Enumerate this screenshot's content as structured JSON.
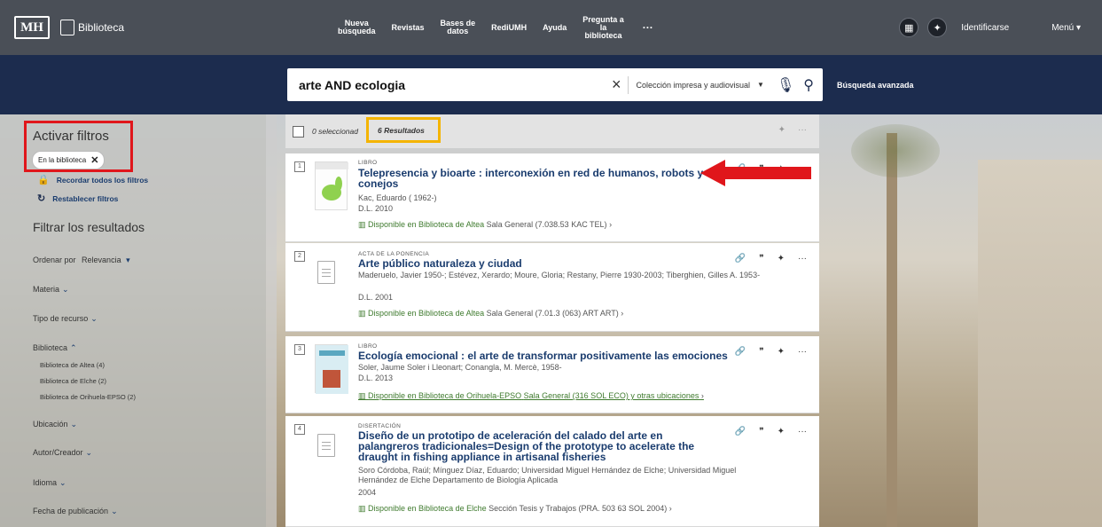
{
  "header": {
    "brand_mark": "MH",
    "brand_name": "Biblioteca",
    "nav": [
      "Nueva\nbúsqueda",
      "Revistas",
      "Bases de\ndatos",
      "RediUMH",
      "Ayuda",
      "Pregunta a\nla\nbiblioteca"
    ],
    "nav_more": "···",
    "login": "Identificarse",
    "menu": "Menú ▾"
  },
  "search": {
    "query": "arte AND ecologia",
    "scope": "Colección impresa y audiovisual",
    "advanced": "Búsqueda avanzada"
  },
  "sidebar": {
    "active_filters_title": "Activar filtros",
    "active_chip": "En la biblioteca",
    "remember_filters": "Recordar todos los filtros",
    "reset_filters": "Restablecer filtros",
    "filter_results_title": "Filtrar los resultados",
    "sort_label": "Ordenar por",
    "sort_value": "Relevancia",
    "facets": [
      "Materia",
      "Tipo de recurso",
      "Biblioteca",
      "Ubicación",
      "Autor/Creador",
      "Idioma",
      "Fecha de publicación"
    ],
    "library_options": [
      "Biblioteca de Altea (4)",
      "Biblioteca de Elche (2)",
      "Biblioteca de Orihuela-EPSO (2)"
    ]
  },
  "results_header": {
    "selected": "0 seleccionad",
    "count": "6 Resultados"
  },
  "results": [
    {
      "num": "1",
      "type": "LIBRO",
      "title": "Telepresencia y bioarte : interconexión en red de humanos, robots y conejos",
      "authors": "Kac, Eduardo ( 1962-)",
      "date": "D.L. 2010",
      "availability": "Disponible en Biblioteca de Altea",
      "location": "Sala General (7.038.53 KAC TEL)"
    },
    {
      "num": "2",
      "type": "ACTA DE LA PONENCIA",
      "title": "Arte público naturaleza y ciudad",
      "authors": "Maderuelo, Javier 1950-; Estévez, Xerardo; Moure, Gloria; Restany, Pierre 1930-2003; Tiberghien, Gilles A. 1953-",
      "date": "D.L. 2001",
      "availability": "Disponible en Biblioteca de Altea",
      "location": "Sala General (7.01.3 (063) ART ART)"
    },
    {
      "num": "3",
      "type": "LIBRO",
      "title": "Ecología emocional : el arte de transformar positivamente las emociones",
      "authors": "Soler, Jaume Soler i Lleonart; Conangla, M. Mercè, 1958-",
      "date": "D.L. 2013",
      "availability": "Disponible en Biblioteca de Orihuela-EPSO",
      "location": "Sala General (316 SOL ECO) y otras ubicaciones"
    },
    {
      "num": "4",
      "type": "DISERTACIÓN",
      "title": "Diseño de un prototipo de aceleración del calado del arte en palangreros tradicionales=Design of the prototype to acelerate the draught in fishing appliance in artisanal fisheries",
      "authors": "Soro Córdoba, Raúl; Mínguez Díaz, Eduardo; Universidad Miguel Hernández de Elche; Universidad Miguel Hernández de Elche Departamento de Biología Aplicada",
      "date": "2004",
      "availability": "Disponible en Biblioteca de Elche",
      "location": "Sección Tesis y Trabajos (PRA. 503 63 SOL 2004)"
    }
  ],
  "colors": {
    "top_bar": "#4a4f57",
    "search_band": "#1c2c4e",
    "title_link": "#1a3c6e",
    "available_green": "#3e7a2d",
    "highlight_red": "#e0161b",
    "highlight_yellow": "#f4b400"
  }
}
